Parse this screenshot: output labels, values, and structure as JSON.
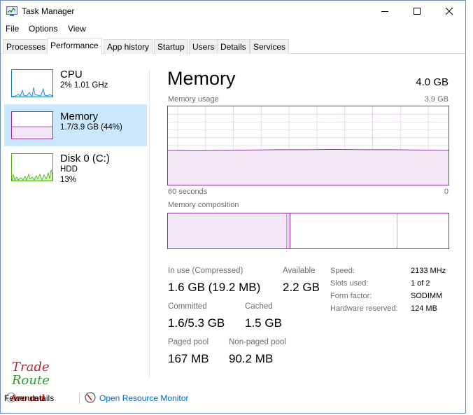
{
  "window": {
    "title": "Task Manager",
    "icon": "task-manager-icon"
  },
  "menu": [
    "File",
    "Options",
    "View"
  ],
  "tabs": [
    "Processes",
    "Performance",
    "App history",
    "Startup",
    "Users",
    "Details",
    "Services"
  ],
  "active_tab": "Performance",
  "sidebar": [
    {
      "name": "CPU",
      "line1": "2% 1.01 GHz",
      "line2": "",
      "color": "#117dbb"
    },
    {
      "name": "Memory",
      "line1": "1.7/3.9 GB (44%)",
      "line2": "",
      "color": "#8b2f9f",
      "selected": true
    },
    {
      "name": "Disk 0 (C:)",
      "line1": "HDD",
      "line2": "13%",
      "color": "#4da60c"
    }
  ],
  "main": {
    "title": "Memory",
    "total": "4.0 GB",
    "usage_label": "Memory usage",
    "usage_max": "3.9 GB",
    "time_left": "60 seconds",
    "time_right": "0",
    "composition_label": "Memory composition",
    "usage_percent": 44
  },
  "stats": {
    "in_use_label": "In use (Compressed)",
    "in_use_value": "1.6 GB (19.2 MB)",
    "available_label": "Available",
    "available_value": "2.2 GB",
    "committed_label": "Committed",
    "committed_value": "1.6/5.3 GB",
    "cached_label": "Cached",
    "cached_value": "1.5 GB",
    "paged_label": "Paged pool",
    "paged_value": "167 MB",
    "nonpaged_label": "Non-paged pool",
    "nonpaged_value": "90.2 MB"
  },
  "specs": [
    {
      "key": "Speed:",
      "value": "2133 MHz"
    },
    {
      "key": "Slots used:",
      "value": "1 of 2"
    },
    {
      "key": "Form factor:",
      "value": "SODIMM"
    },
    {
      "key": "Hardware reserved:",
      "value": "124 MB"
    }
  ],
  "footer": {
    "fewer_details": "Fewer details",
    "open_monitor": "Open Resource Monitor"
  },
  "watermark": {
    "line1": "Trade",
    "line2": "Route",
    "line3": "Around"
  },
  "colors": {
    "memory": "#8b2f9f",
    "selected_bg": "#cce8ff",
    "link": "#0066cc"
  }
}
